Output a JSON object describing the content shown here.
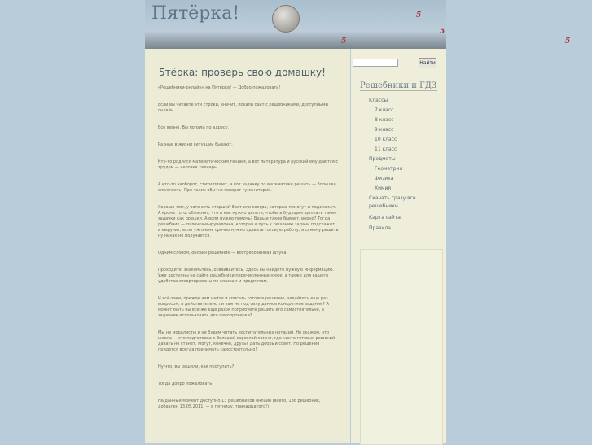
{
  "site": {
    "title": "Пятёрка!"
  },
  "post": {
    "title": "5тёрка: проверь свою домашку!",
    "paragraphs": [
      "«Решебники-онлайн» на Пятёрке! — Добро пожаловать!",
      "Если вы читаете эти строки, значит, искали сайт с решебниками, доступными онлайн.",
      "Все верно. Вы попали по адресу.",
      "Разные в жизни ситуации бывают.",
      "Кто-то родился математическим гением, а вот литература и русский ему даются с трудом — человек технарь.",
      "А кто-то наоборот, стихи пишет, а вот задачку по математике решить — большая сложность! Про таких обычно говорят гуманитарий.",
      "Хорошо тем, у кого есть старший брат или сестра, которые помогут и подскажут. А кроме того, объяснят, что и как нужно делать, чтобы в будущем щелкать такие задачки как орешки. А если нужно помочь? Ведь и такое бывает, верно? Тогда решебник — палочка-выручалочка, которая и путь к решению задачи подскажет, и выручит, если уж очень срочно нужно сдавать готовую работу, а самому решить ну никак не получается.",
      "Одним словом, онлайн решебник — востребованная штука.",
      "Проходите, знакомьтесь, осваивайтесь. Здесь вы найдете нужную информацию. Уже доступны на сайте решебники перечисленные ниже, а также для вашего удобства отсортированы по классам и предметам.",
      "И всё-таки, прежде чем найти и списать готовое решение, задайтесь еще раз вопросом, а действительно ли вам не под силу данное конкретное задание? А может быть вы все же еще разок попробуете решить его самостоятельно, а задачник использовать для самопроверки?",
      "Мы не моралисты и не будем читать воспитательных нотаций. Но скажем, что школа — это подготовка к большой взрослой жизни, где никто готовых решений давать не станет. Могут, конечно, друзья дать добрый совет. Но решения придется всегда принимать самостоятельно!",
      "Ну что, вы решили, как поступить?",
      "Тогда добро пожаловать!",
      "На данный момент доступно 13 решебников онлайн (всего, 136 решебник, добавлен 13.05.2011, — в пятницу, тринадцатого!)"
    ]
  },
  "search": {
    "placeholder": "",
    "value": "",
    "button_label": "Найти"
  },
  "sidebar": {
    "title": "Решебники и ГДЗ",
    "items": [
      {
        "label": "Классы",
        "level": 0
      },
      {
        "label": "7 класс",
        "level": 1
      },
      {
        "label": "8 класс",
        "level": 1
      },
      {
        "label": "9 класс",
        "level": 1
      },
      {
        "label": "10 класс",
        "level": 1
      },
      {
        "label": "11 класс",
        "level": 1
      },
      {
        "label": "Предметы",
        "level": 0
      },
      {
        "label": "Геометрия",
        "level": 1
      },
      {
        "label": "Физика",
        "level": 1
      },
      {
        "label": "Химия",
        "level": 1
      },
      {
        "label": "Скачать сразу все",
        "level": 0
      },
      {
        "label": "решебники",
        "level": 0
      },
      {
        "label": "Карта сайта",
        "level": 0
      },
      {
        "label": "Правила",
        "level": 0
      }
    ]
  },
  "decor": {
    "five_glyph": "5",
    "colors": {
      "accent": "#b0332f",
      "page_bg": "#b9ccd9",
      "content_bg": "#ecebd6"
    }
  }
}
